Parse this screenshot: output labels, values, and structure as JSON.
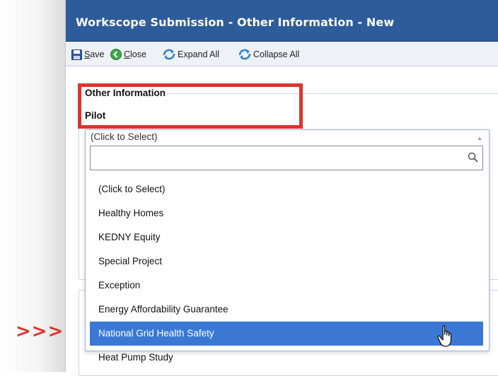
{
  "window": {
    "title": "Workscope Submission - Other Information - New"
  },
  "toolbar": {
    "save_label": "Save",
    "close_label": "Close",
    "expand_label": "Expand All",
    "collapse_label": "Collapse All"
  },
  "section": {
    "legend": "Other Information",
    "field_label": "Pilot"
  },
  "dropdown": {
    "selected_display": "(Click to Select)",
    "search_value": "",
    "options": [
      "(Click to Select)",
      "Healthy Homes",
      "KEDNY Equity",
      "Special Project",
      "Exception",
      "Energy Affordability Guarantee",
      "National Grid Health Safety",
      "Heat Pump Study"
    ],
    "highlighted_index": 6
  },
  "annotation": {
    "arrows": ">>>",
    "color": "#d9362e"
  },
  "colors": {
    "titlebar": "#2e5c9a",
    "selection": "#3a78d4"
  }
}
